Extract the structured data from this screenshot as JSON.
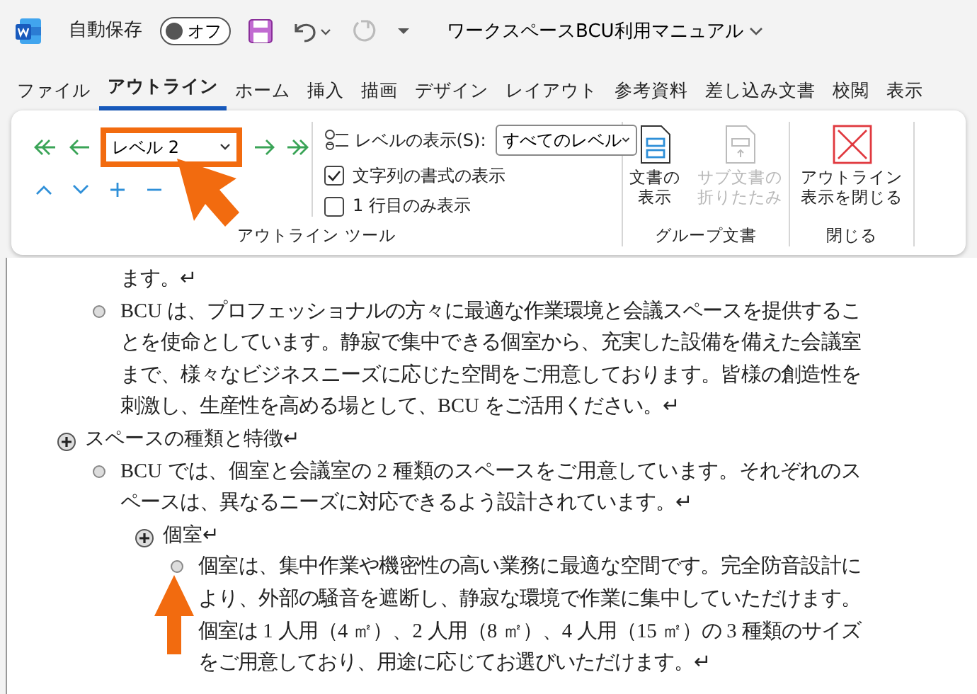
{
  "title_bar": {
    "autosave_label": "自動保存",
    "autosave_toggle": {
      "label": "オフ",
      "on": false
    },
    "document_title": "ワークスペースBCU利用マニュアル"
  },
  "tabs": [
    {
      "label": "ファイル",
      "selected": false
    },
    {
      "label": "アウトライン",
      "selected": true
    },
    {
      "label": "ホーム",
      "selected": false
    },
    {
      "label": "挿入",
      "selected": false
    },
    {
      "label": "描画",
      "selected": false
    },
    {
      "label": "デザイン",
      "selected": false
    },
    {
      "label": "レイアウト",
      "selected": false
    },
    {
      "label": "参考資料",
      "selected": false
    },
    {
      "label": "差し込み文書",
      "selected": false
    },
    {
      "label": "校閲",
      "selected": false
    },
    {
      "label": "表示",
      "selected": false
    }
  ],
  "ribbon": {
    "outline_tools": {
      "level_select": {
        "value": "レベル 2",
        "highlighted": true
      },
      "show_level": {
        "label": "レベルの表示(S):",
        "value": "すべてのレベル"
      },
      "checkboxes": [
        {
          "label": "文字列の書式の表示",
          "checked": true
        },
        {
          "label": "1 行目のみ表示",
          "checked": false
        }
      ],
      "group_label": "アウトライン ツール"
    },
    "master_document": {
      "buttons": [
        {
          "kind": "show",
          "label_lines": [
            "文書の",
            "表示"
          ],
          "disabled": false
        },
        {
          "kind": "collapse",
          "label_lines": [
            "サブ文書の",
            "折りたたみ"
          ],
          "disabled": true
        }
      ],
      "group_label": "グループ文書"
    },
    "close": {
      "button_lines": [
        "アウトライン",
        "表示を閉じる"
      ],
      "group_label": "閉じる"
    }
  },
  "document": {
    "continued_items": [
      {
        "kind": "continuation",
        "text": "ます。↵"
      },
      {
        "kind": "body",
        "text": "BCU は、プロフェッショナルの方々に最適な作業環境と会議スペースを提供することを使命としています。静寂で集中できる個室から、充実した設備を備えた会議室まで、様々なビジネスニーズに応じた空間をご用意しております。皆様の創造性を刺激し、生産性を高める場として、BCU をご活用ください。↵"
      }
    ],
    "items": [
      {
        "kind": "heading",
        "text": "スペースの種類と特徴↵",
        "children": [
          {
            "kind": "body",
            "text": "BCU では、個室と会議室の 2 種類のスペースをご用意しています。それぞれのスペースは、異なるニーズに対応できるよう設計されています。↵"
          },
          {
            "kind": "heading",
            "text": "個室↵",
            "children": [
              {
                "kind": "body",
                "text": "個室は、集中作業や機密性の高い業務に最適な空間です。完全防音設計により、外部の騒音を遮断し、静寂な環境で作業に集中していただけます。個室は 1 人用（4 ㎡）、2 人用（8 ㎡）、4 人用（15 ㎡）の 3 種類のサイズをご用意しており、用途に応じてお選びいただけます。↵"
              }
            ]
          }
        ]
      }
    ]
  },
  "annotations": {
    "pointer_arrow": true,
    "up_arrow": true
  }
}
